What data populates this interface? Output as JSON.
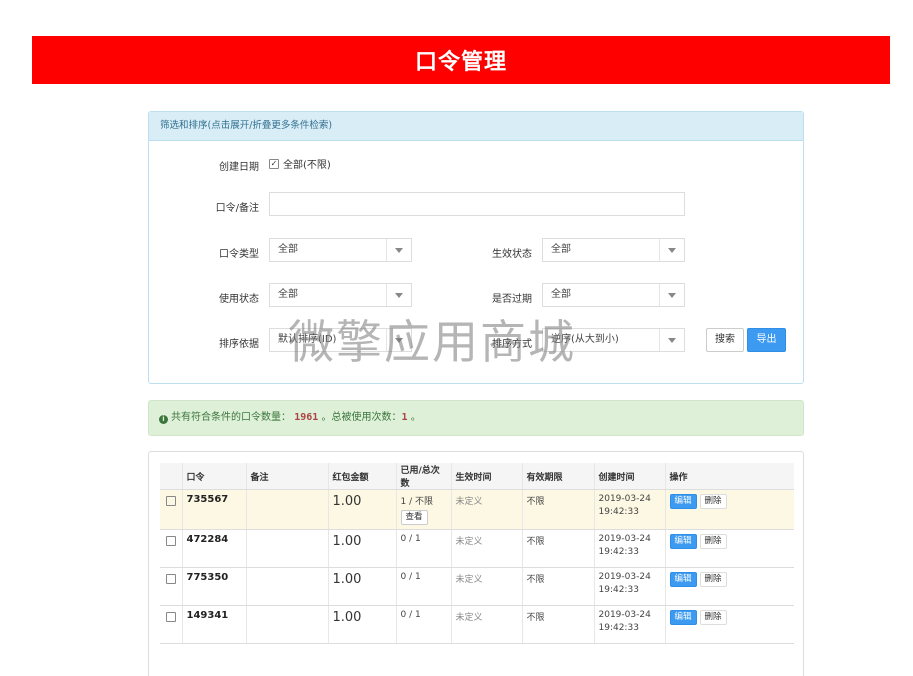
{
  "header": {
    "title": "口令管理"
  },
  "filter": {
    "panel_title": "筛选和排序(点击展开/折叠更多条件检索)",
    "created_date": {
      "label": "创建日期",
      "checkbox_label": "全部(不限)",
      "checked": true
    },
    "code_note": {
      "label": "口令/备注",
      "value": ""
    },
    "code_type": {
      "label": "口令类型",
      "value": "全部"
    },
    "effective_status": {
      "label": "生效状态",
      "value": "全部"
    },
    "usage_status": {
      "label": "使用状态",
      "value": "全部"
    },
    "expired": {
      "label": "是否过期",
      "value": "全部"
    },
    "sort_by": {
      "label": "排序依据",
      "value": "默认排序(ID)"
    },
    "sort_order": {
      "label": "排序方式",
      "value": "逆序(从大到小)"
    },
    "search_label": "搜索",
    "export_label": "导出"
  },
  "watermark": "微擎应用商城",
  "summary": {
    "prefix": "共有符合条件的口令数量：",
    "count": "1961",
    "middle": "。总被使用次数：",
    "used": "1",
    "suffix": "。"
  },
  "table": {
    "headers": [
      "",
      "口令",
      "备注",
      "红包金额",
      "已用/总次数",
      "生效时间",
      "有效期限",
      "创建时间",
      "操作"
    ],
    "edit_label": "编辑",
    "delete_label": "删除",
    "view_label": "查看",
    "rows": [
      {
        "code": "735567",
        "note": "",
        "amount": "1.00",
        "usage": "1 / 不限",
        "effective": "未定义",
        "validity": "不限",
        "created_date": "2019-03-24",
        "created_time": "19:42:33"
      },
      {
        "code": "472284",
        "note": "",
        "amount": "1.00",
        "usage": "0 / 1",
        "effective": "未定义",
        "validity": "不限",
        "created_date": "2019-03-24",
        "created_time": "19:42:33"
      },
      {
        "code": "775350",
        "note": "",
        "amount": "1.00",
        "usage": "0 / 1",
        "effective": "未定义",
        "validity": "不限",
        "created_date": "2019-03-24",
        "created_time": "19:42:33"
      },
      {
        "code": "149341",
        "note": "",
        "amount": "1.00",
        "usage": "0 / 1",
        "effective": "未定义",
        "validity": "不限",
        "created_date": "2019-03-24",
        "created_time": "19:42:33"
      }
    ]
  }
}
